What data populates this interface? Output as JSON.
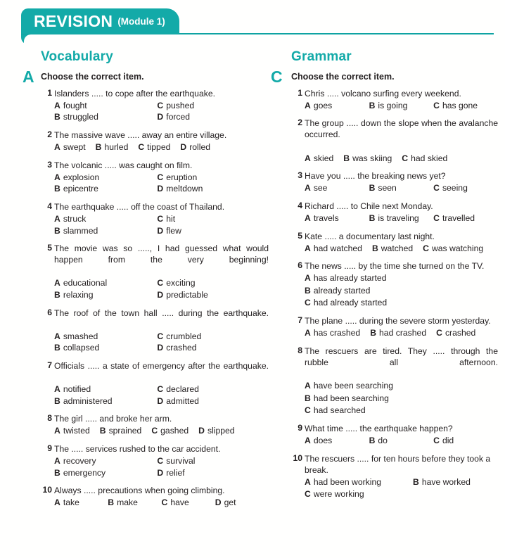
{
  "header": {
    "title": "REVISION",
    "module": "(Module 1)",
    "accent_color": "#13aaa8"
  },
  "vocabulary": {
    "heading": "Vocabulary",
    "task_letter": "A",
    "instruction": "Choose the correct item.",
    "questions": [
      {
        "num": "1",
        "stem": "Islanders ..... to cope after the earthquake.",
        "layout": "grid",
        "options": [
          {
            "label": "A",
            "text": "fought"
          },
          {
            "label": "C",
            "text": "pushed"
          },
          {
            "label": "B",
            "text": "struggled"
          },
          {
            "label": "D",
            "text": "forced"
          }
        ]
      },
      {
        "num": "2",
        "stem": "The massive wave ..... away an entire village.",
        "layout": "row4",
        "options": [
          {
            "label": "A",
            "text": "swept"
          },
          {
            "label": "B",
            "text": "hurled"
          },
          {
            "label": "C",
            "text": "tipped"
          },
          {
            "label": "D",
            "text": "rolled"
          }
        ]
      },
      {
        "num": "3",
        "stem": "The volcanic ..... was caught on film.",
        "layout": "grid",
        "options": [
          {
            "label": "A",
            "text": "explosion"
          },
          {
            "label": "C",
            "text": "eruption"
          },
          {
            "label": "B",
            "text": "epicentre"
          },
          {
            "label": "D",
            "text": "meltdown"
          }
        ]
      },
      {
        "num": "4",
        "stem": "The earthquake ..... off the coast of Thailand.",
        "layout": "grid",
        "options": [
          {
            "label": "A",
            "text": "struck"
          },
          {
            "label": "C",
            "text": "hit"
          },
          {
            "label": "B",
            "text": "slammed"
          },
          {
            "label": "D",
            "text": "flew"
          }
        ]
      },
      {
        "num": "5",
        "stem": "The movie was so ....., I had guessed what would happen from the very beginning!",
        "layout": "grid",
        "justify": true,
        "options": [
          {
            "label": "A",
            "text": "educational"
          },
          {
            "label": "C",
            "text": "exciting"
          },
          {
            "label": "B",
            "text": "relaxing"
          },
          {
            "label": "D",
            "text": "predictable"
          }
        ]
      },
      {
        "num": "6",
        "stem": "The roof of the town hall ..... during the earthquake.",
        "layout": "grid",
        "justify": true,
        "options": [
          {
            "label": "A",
            "text": "smashed"
          },
          {
            "label": "C",
            "text": "crumbled"
          },
          {
            "label": "B",
            "text": "collapsed"
          },
          {
            "label": "D",
            "text": "crashed"
          }
        ]
      },
      {
        "num": "7",
        "stem": "Officials ..... a state of emergency after the earthquake.",
        "layout": "grid",
        "justify": true,
        "options": [
          {
            "label": "A",
            "text": "notified"
          },
          {
            "label": "C",
            "text": "declared"
          },
          {
            "label": "B",
            "text": "administered"
          },
          {
            "label": "D",
            "text": "admitted"
          }
        ]
      },
      {
        "num": "8",
        "stem": "The girl ..... and broke her arm.",
        "layout": "row4",
        "options": [
          {
            "label": "A",
            "text": "twisted"
          },
          {
            "label": "B",
            "text": "sprained"
          },
          {
            "label": "C",
            "text": "gashed"
          },
          {
            "label": "D",
            "text": "slipped"
          }
        ]
      },
      {
        "num": "9",
        "stem": "The ..... services rushed to the car accident.",
        "layout": "grid",
        "options": [
          {
            "label": "A",
            "text": "recovery"
          },
          {
            "label": "C",
            "text": "survival"
          },
          {
            "label": "B",
            "text": "emergency"
          },
          {
            "label": "D",
            "text": "relief"
          }
        ]
      },
      {
        "num": "10",
        "stem": "Always ..... precautions when going climbing.",
        "layout": "row4spread",
        "options": [
          {
            "label": "A",
            "text": "take"
          },
          {
            "label": "B",
            "text": "make"
          },
          {
            "label": "C",
            "text": "have"
          },
          {
            "label": "D",
            "text": "get"
          }
        ]
      }
    ]
  },
  "grammar": {
    "heading": "Grammar",
    "task_letter": "C",
    "instruction": "Choose the correct item.",
    "questions": [
      {
        "num": "1",
        "stem": "Chris ..... volcano surfing every weekend.",
        "layout": "row3spread",
        "options": [
          {
            "label": "A",
            "text": "goes"
          },
          {
            "label": "B",
            "text": "is going"
          },
          {
            "label": "C",
            "text": "has gone"
          }
        ]
      },
      {
        "num": "2",
        "stem": "The group ..... down the slope when the avalanche occurred.",
        "layout": "row3",
        "justify": true,
        "options": [
          {
            "label": "A",
            "text": "skied"
          },
          {
            "label": "B",
            "text": "was skiing"
          },
          {
            "label": "C",
            "text": "had skied"
          }
        ]
      },
      {
        "num": "3",
        "stem": "Have you ..... the breaking news yet?",
        "layout": "row3spread",
        "options": [
          {
            "label": "A",
            "text": "see"
          },
          {
            "label": "B",
            "text": "seen"
          },
          {
            "label": "C",
            "text": "seeing"
          }
        ]
      },
      {
        "num": "4",
        "stem": "Richard ..... to Chile next Monday.",
        "layout": "row3spread",
        "options": [
          {
            "label": "A",
            "text": "travels"
          },
          {
            "label": "B",
            "text": "is traveling"
          },
          {
            "label": "C",
            "text": "travelled"
          }
        ]
      },
      {
        "num": "5",
        "stem": "Kate ..... a documentary last night.",
        "layout": "row3",
        "options": [
          {
            "label": "A",
            "text": "had watched"
          },
          {
            "label": "B",
            "text": "watched"
          },
          {
            "label": "C",
            "text": "was watching"
          }
        ]
      },
      {
        "num": "6",
        "stem": "The news ..... by the time she turned on the TV.",
        "layout": "stack",
        "options": [
          {
            "label": "A",
            "text": "has already started"
          },
          {
            "label": "B",
            "text": "already started"
          },
          {
            "label": "C",
            "text": "had already started"
          }
        ]
      },
      {
        "num": "7",
        "stem": "The plane ..... during the severe storm yesterday.",
        "layout": "row3",
        "options": [
          {
            "label": "A",
            "text": "has crashed"
          },
          {
            "label": "B",
            "text": "had crashed"
          },
          {
            "label": "C",
            "text": "crashed"
          }
        ]
      },
      {
        "num": "8",
        "stem": "The rescuers are tired. They ..... through the rubble all afternoon.",
        "layout": "stack",
        "justify": true,
        "options": [
          {
            "label": "A",
            "text": "have been searching"
          },
          {
            "label": "B",
            "text": "had been searching"
          },
          {
            "label": "C",
            "text": "had searched"
          }
        ]
      },
      {
        "num": "9",
        "stem": "What time ..... the earthquake happen?",
        "layout": "row3spread",
        "options": [
          {
            "label": "A",
            "text": "does"
          },
          {
            "label": "B",
            "text": "do"
          },
          {
            "label": "C",
            "text": "did"
          }
        ]
      },
      {
        "num": "10",
        "stem": "The rescuers ..... for ten hours before they took a break.",
        "layout": "half",
        "options": [
          {
            "label": "A",
            "text": "had been working"
          },
          {
            "label": "B",
            "text": "have worked"
          },
          {
            "label": "C",
            "text": "were working"
          }
        ]
      }
    ]
  }
}
